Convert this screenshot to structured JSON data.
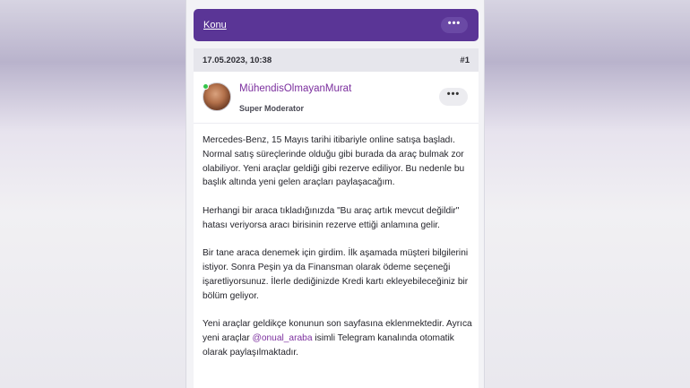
{
  "topic_bar": {
    "label": "Konu",
    "menu": "•••"
  },
  "post": {
    "date": "17.05.2023, 10:38",
    "number": "#1",
    "author": {
      "name": "MühendisOlmayanMurat",
      "role": "Super Moderator",
      "menu": "•••",
      "online": true
    },
    "paragraphs": [
      "Mercedes-Benz, 15 Mayıs tarihi itibariyle online satışa başladı. Normal satış süreçlerinde olduğu gibi burada da araç bulmak zor olabiliyor. Yeni araçlar geldiği gibi rezerve ediliyor. Bu nedenle bu başlık altında yeni gelen araçları paylaşacağım.",
      "Herhangi bir araca tıkladığınızda \"Bu araç artık mevcut değildir\" hatası veriyorsa aracı birisinin rezerve ettiği anlamına gelir.",
      "Bir tane araca denemek için girdim. İlk aşamada müşteri bilgilerini istiyor. Sonra Peşin ya da Finansman olarak ödeme seçeneği işaretliyorsunuz. İlerle dediğinizde Kredi kartı ekleyebileceğiniz bir bölüm geliyor."
    ],
    "last_paragraph": {
      "before_mention": "Yeni araçlar geldikçe konunun son sayfasına eklenmektedir. Ayrıca yeni araçlar ",
      "mention": "@onual_araba",
      "after_mention": " isimli Telegram kanalında otomatik olarak paylaşılmaktadır."
    }
  },
  "colors": {
    "topic_bar": "#5a3596",
    "username": "#7b2f9e",
    "online": "#34c54a"
  }
}
